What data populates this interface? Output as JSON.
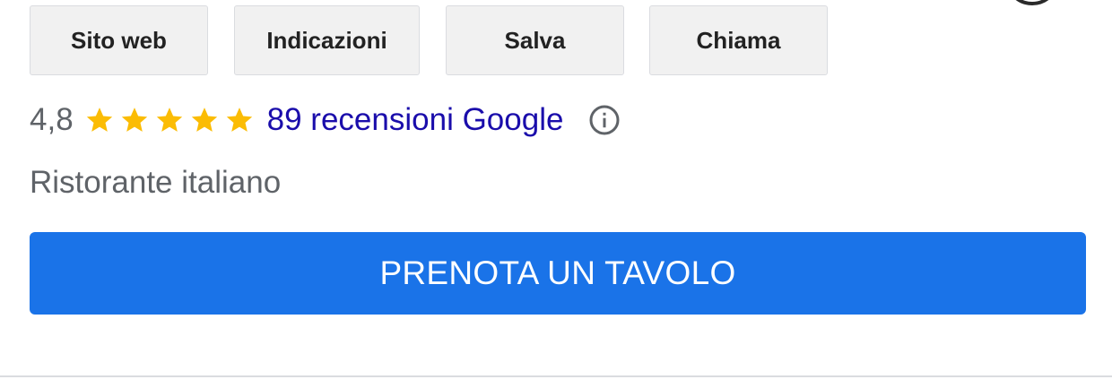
{
  "actions": {
    "website_label": "Sito web",
    "directions_label": "Indicazioni",
    "save_label": "Salva",
    "call_label": "Chiama"
  },
  "rating": {
    "value": "4,8",
    "stars": 5,
    "reviews_link": "89 recensioni Google"
  },
  "business": {
    "category": "Ristorante italiano"
  },
  "reserve": {
    "label": "PRENOTA UN TAVOLO"
  },
  "icons": {
    "star": "star-icon",
    "info": "info-icon"
  },
  "colors": {
    "star": "#fbbc04",
    "link": "#1a0dab",
    "primary_button": "#1a73e8",
    "secondary_text": "#5f6368"
  }
}
